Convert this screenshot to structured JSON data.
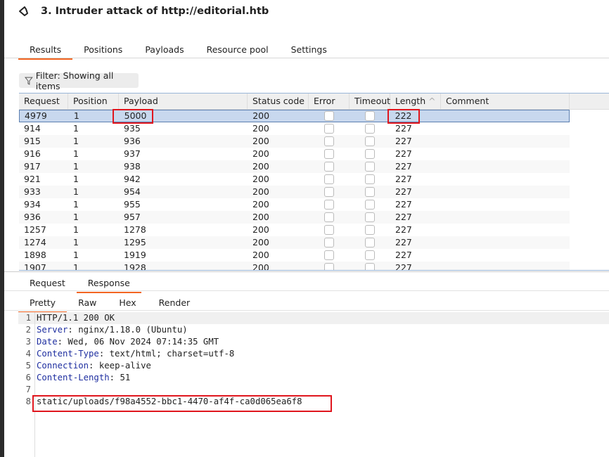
{
  "title": "3. Intruder attack of http://editorial.htb",
  "tabs": [
    "Results",
    "Positions",
    "Payloads",
    "Resource pool",
    "Settings"
  ],
  "filter": "Filter: Showing all items",
  "columns": [
    "Request",
    "Position",
    "Payload",
    "Status code",
    "Error",
    "Timeout",
    "Length",
    "Comment"
  ],
  "rows": [
    [
      "4979",
      "1",
      "5000",
      "200",
      "222"
    ],
    [
      "914",
      "1",
      "935",
      "200",
      "227"
    ],
    [
      "915",
      "1",
      "936",
      "200",
      "227"
    ],
    [
      "916",
      "1",
      "937",
      "200",
      "227"
    ],
    [
      "917",
      "1",
      "938",
      "200",
      "227"
    ],
    [
      "921",
      "1",
      "942",
      "200",
      "227"
    ],
    [
      "933",
      "1",
      "954",
      "200",
      "227"
    ],
    [
      "934",
      "1",
      "955",
      "200",
      "227"
    ],
    [
      "936",
      "1",
      "957",
      "200",
      "227"
    ],
    [
      "1257",
      "1",
      "1278",
      "200",
      "227"
    ],
    [
      "1274",
      "1",
      "1295",
      "200",
      "227"
    ],
    [
      "1898",
      "1",
      "1919",
      "200",
      "227"
    ],
    [
      "1907",
      "1",
      "1928",
      "200",
      "227"
    ]
  ],
  "message_tabs": [
    "Request",
    "Response"
  ],
  "view_tabs": [
    "Pretty",
    "Raw",
    "Hex",
    "Render"
  ],
  "response_lines": [
    {
      "n": "1",
      "key": "",
      "val": "HTTP/1.1 200 OK"
    },
    {
      "n": "2",
      "key": "Server",
      "val": ": nginx/1.18.0 (Ubuntu)"
    },
    {
      "n": "3",
      "key": "Date",
      "val": ": Wed, 06 Nov 2024 07:14:35 GMT"
    },
    {
      "n": "4",
      "key": "Content-Type",
      "val": ": text/html; charset=utf-8"
    },
    {
      "n": "5",
      "key": "Connection",
      "val": ": keep-alive"
    },
    {
      "n": "6",
      "key": "Content-Length",
      "val": ": 51"
    },
    {
      "n": "7",
      "key": "",
      "val": ""
    },
    {
      "n": "8",
      "key": "",
      "val": "static/uploads/f98a4552-bbc1-4470-af4f-ca0d065ea6f8"
    }
  ],
  "colors": {
    "accent": "#f26522",
    "highlight": "#e0161e",
    "selected_row": "#c8d8ee"
  }
}
